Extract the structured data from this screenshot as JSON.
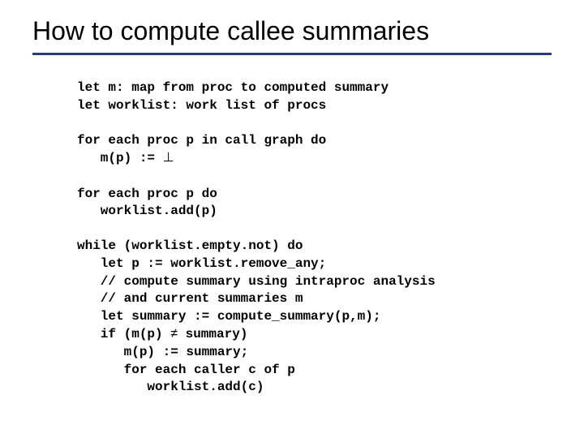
{
  "title": "How to compute callee summaries",
  "code": {
    "l1": "let m: map from proc to computed summary",
    "l2": "let worklist: work list of procs",
    "l3": "",
    "l4": "for each proc p in call graph do",
    "l5a": "   m(p) := ",
    "l5b": "⊥",
    "l6": "",
    "l7": "for each proc p do",
    "l8": "   worklist.add(p)",
    "l9": "",
    "l10": "while (worklist.empty.not) do",
    "l11": "   let p := worklist.remove_any;",
    "l12": "   // compute summary using intraproc analysis",
    "l13": "   // and current summaries m",
    "l14": "   let summary := compute_summary(p,m);",
    "l15a": "   if (m(p) ",
    "l15b": "≠",
    "l15c": " summary)",
    "l16": "      m(p) := summary;",
    "l17": "      for each caller c of p",
    "l18": "         worklist.add(c)"
  }
}
